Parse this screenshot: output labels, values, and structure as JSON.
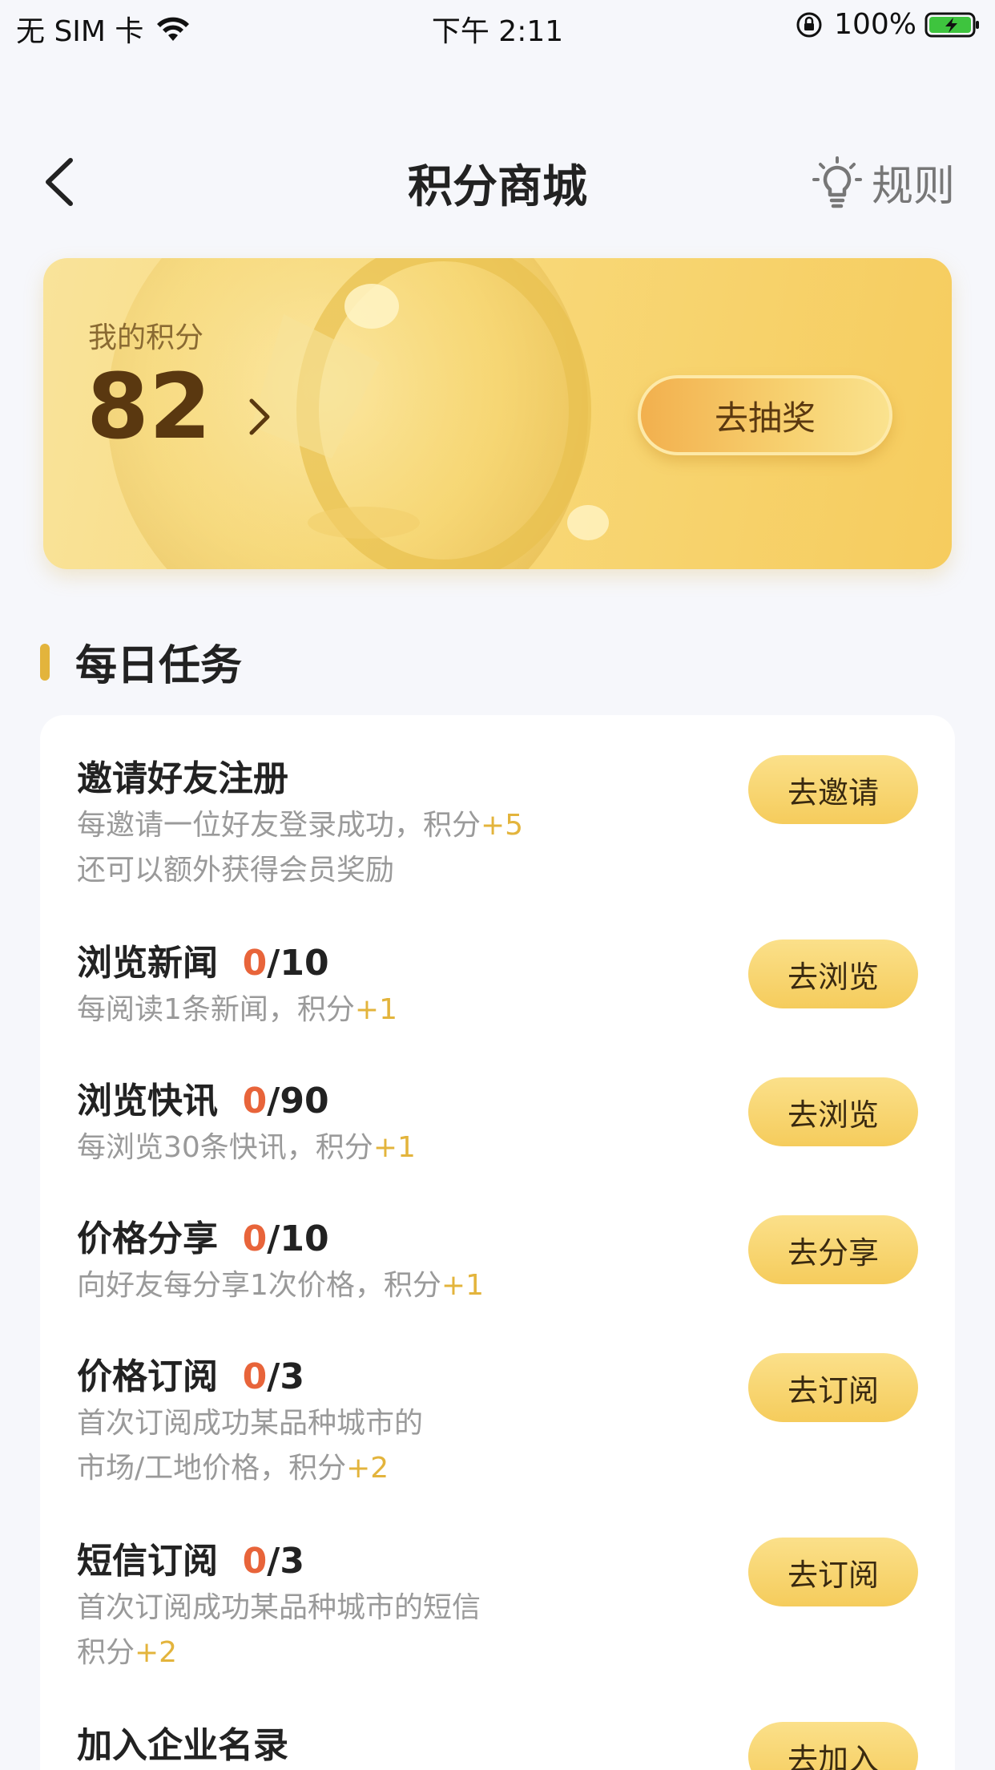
{
  "status_bar": {
    "carrier": "无 SIM 卡",
    "time": "下午 2:11",
    "battery": "100%"
  },
  "nav": {
    "title": "积分商城",
    "rules_label": "规则"
  },
  "points": {
    "label": "我的积分",
    "value": "82",
    "lottery_label": "去抽奖"
  },
  "section": {
    "title": "每日任务"
  },
  "tasks": [
    {
      "title": "邀请好友注册",
      "progress_done": "",
      "progress_total": "",
      "desc_lines": [
        {
          "text": "每邀请一位好友登录成功，积分",
          "bonus": "+5"
        },
        {
          "text": "还可以额外获得会员奖励",
          "bonus": ""
        }
      ],
      "button": "去邀请"
    },
    {
      "title": "浏览新闻",
      "progress_done": "0",
      "progress_total": "/10",
      "desc_lines": [
        {
          "text": "每阅读1条新闻，积分",
          "bonus": "+1"
        }
      ],
      "button": "去浏览"
    },
    {
      "title": "浏览快讯",
      "progress_done": "0",
      "progress_total": "/90",
      "desc_lines": [
        {
          "text": "每浏览30条快讯，积分",
          "bonus": "+1"
        }
      ],
      "button": "去浏览"
    },
    {
      "title": "价格分享",
      "progress_done": "0",
      "progress_total": "/10",
      "desc_lines": [
        {
          "text": "向好友每分享1次价格，积分",
          "bonus": "+1"
        }
      ],
      "button": "去分享"
    },
    {
      "title": "价格订阅",
      "progress_done": "0",
      "progress_total": "/3",
      "desc_lines": [
        {
          "text": "首次订阅成功某品种城市的",
          "bonus": ""
        },
        {
          "text": "市场/工地价格，积分",
          "bonus": "+2"
        }
      ],
      "button": "去订阅"
    },
    {
      "title": "短信订阅",
      "progress_done": "0",
      "progress_total": "/3",
      "desc_lines": [
        {
          "text": "首次订阅成功某品种城市的短信",
          "bonus": ""
        },
        {
          "text": "积分",
          "bonus": "+2"
        }
      ],
      "button": "去订阅"
    },
    {
      "title": "加入企业名录",
      "progress_done": "",
      "progress_total": "",
      "desc_lines": [],
      "button": "去加入"
    }
  ]
}
